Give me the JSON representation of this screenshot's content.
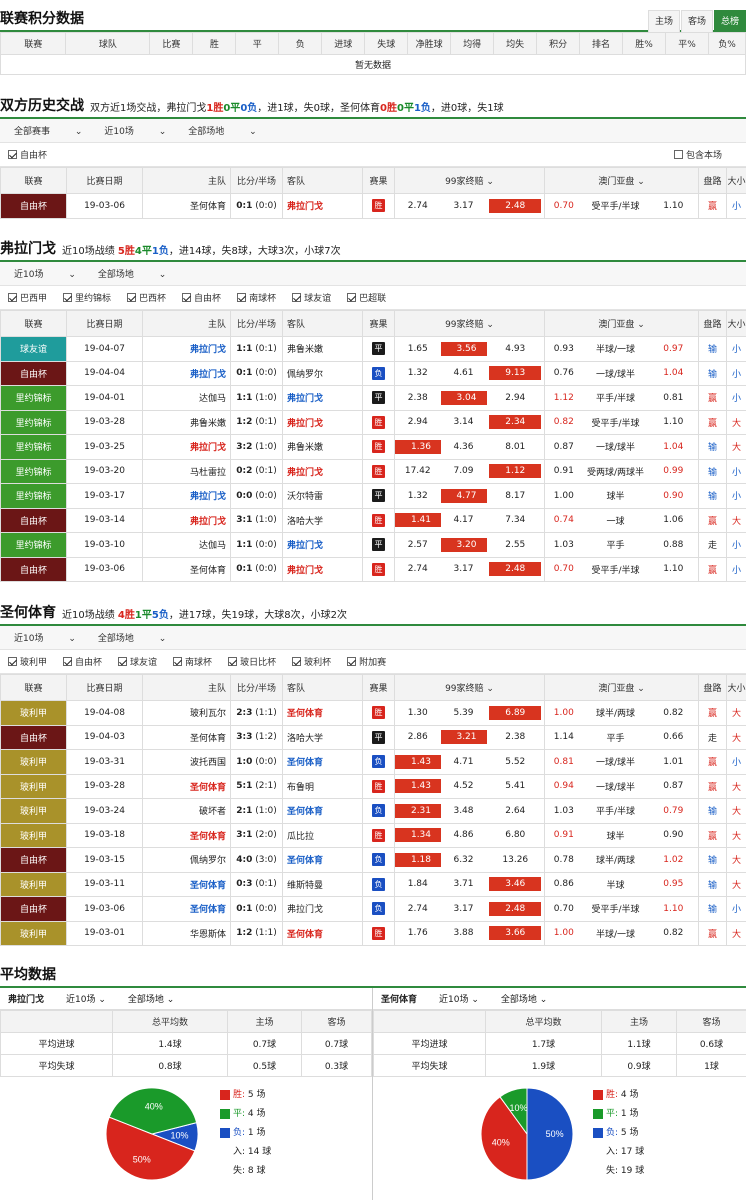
{
  "standings": {
    "title": "联赛积分数据",
    "tabs": [
      "主场",
      "客场",
      "总榜"
    ],
    "headers": [
      "联赛",
      "球队",
      "比赛",
      "胜",
      "平",
      "负",
      "进球",
      "失球",
      "净胜球",
      "均得",
      "均失",
      "积分",
      "排名",
      "胜%",
      "平%",
      "负%"
    ],
    "empty": "暂无数据"
  },
  "h2h": {
    "title": "双方历史交战",
    "summary": {
      "pre": "双方近1场交战，弗拉门戈",
      "w": "1胜",
      "d": "0平",
      "l": "0负",
      "mid": "，进1球，失0球，圣何体育",
      "w2": "0胜",
      "d2": "0平",
      "l2": "1负",
      "post": "，进0球，失1球"
    },
    "filters": [
      "全部赛事",
      "近10场",
      "全部场地"
    ],
    "checks": [
      "自由杯"
    ],
    "contain": "包含本场",
    "headers": [
      "联赛",
      "比赛日期",
      "主队",
      "比分/半场",
      "客队",
      "赛果",
      "99家终赔",
      "澳门亚盘",
      "盘路",
      "大小"
    ],
    "rows": [
      {
        "league": "自由杯",
        "lc": "zy",
        "date": "19-03-06",
        "home": "圣何体育",
        "hs": "n",
        "score": "0:1",
        "half": "(0:0)",
        "away": "弗拉门戈",
        "as": "r",
        "res": "胜",
        "rc": "w",
        "o1": "2.74",
        "o2": "3.17",
        "o3": "2.48",
        "hi": 3,
        "a1": "0.70",
        "a1c": "r",
        "hcp": "受平手/半球",
        "a2": "1.10",
        "a2c": "n",
        "pl": "赢",
        "plc": "r",
        "ou": "小",
        "ouc": "b"
      }
    ]
  },
  "flamengo": {
    "title": "弗拉门戈",
    "summary": {
      "pre": "近10场战绩",
      "w": "5胜",
      "d": "4平",
      "l": "1负",
      "post": "，进14球，失8球，大球3次，小球7次"
    },
    "filters": [
      "近10场",
      "全部场地"
    ],
    "checks": [
      "巴西甲",
      "里约锦标",
      "巴西杯",
      "自由杯",
      "南球杯",
      "球友谊",
      "巴超联"
    ],
    "rows": [
      {
        "league": "球友谊",
        "lc": "yq",
        "date": "19-04-07",
        "home": "弗拉门戈",
        "hs": "b",
        "score": "1:1",
        "half": "(0:1)",
        "away": "弗鲁米嫩",
        "as": "n",
        "res": "平",
        "rc": "d",
        "o1": "1.65",
        "o2": "3.56",
        "o3": "4.93",
        "hi": 2,
        "a1": "0.93",
        "a1c": "n",
        "hcp": "半球/一球",
        "a2": "0.97",
        "a2c": "r",
        "pl": "输",
        "plc": "b",
        "ou": "小",
        "ouc": "b"
      },
      {
        "league": "自由杯",
        "lc": "zy",
        "date": "19-04-04",
        "home": "弗拉门戈",
        "hs": "bl",
        "score": "0:1",
        "half": "(0:0)",
        "away": "佩纳罗尔",
        "as": "n",
        "res": "负",
        "rc": "l",
        "o1": "1.32",
        "o2": "4.61",
        "o3": "9.13",
        "hi": 3,
        "a1": "0.76",
        "a1c": "n",
        "hcp": "一球/球半",
        "a2": "1.04",
        "a2c": "r",
        "pl": "输",
        "plc": "b",
        "ou": "小",
        "ouc": "b"
      },
      {
        "league": "里约锦标",
        "lc": "ly",
        "date": "19-04-01",
        "home": "达伽马",
        "hs": "n",
        "score": "1:1",
        "half": "(1:0)",
        "away": "弗拉门戈",
        "as": "b",
        "res": "平",
        "rc": "d",
        "o1": "2.38",
        "o2": "3.04",
        "o3": "2.94",
        "hi": 2,
        "a1": "1.12",
        "a1c": "r",
        "hcp": "平手/半球",
        "a2": "0.81",
        "a2c": "n",
        "pl": "赢",
        "plc": "r",
        "ou": "小",
        "ouc": "b"
      },
      {
        "league": "里约锦标",
        "lc": "ly",
        "date": "19-03-28",
        "home": "弗鲁米嫩",
        "hs": "n",
        "score": "1:2",
        "half": "(0:1)",
        "away": "弗拉门戈",
        "as": "r",
        "res": "胜",
        "rc": "w",
        "o1": "2.94",
        "o2": "3.14",
        "o3": "2.34",
        "hi": 3,
        "a1": "0.82",
        "a1c": "r",
        "hcp": "受平手/半球",
        "a2": "1.10",
        "a2c": "n",
        "pl": "赢",
        "plc": "r",
        "ou": "大",
        "ouc": "r"
      },
      {
        "league": "里约锦标",
        "lc": "ly",
        "date": "19-03-25",
        "home": "弗拉门戈",
        "hs": "r",
        "score": "3:2",
        "half": "(1:0)",
        "away": "弗鲁米嫩",
        "as": "n",
        "res": "胜",
        "rc": "w",
        "o1": "1.36",
        "o2": "4.36",
        "o3": "8.01",
        "hi": 1,
        "a1": "0.87",
        "a1c": "n",
        "hcp": "一球/球半",
        "a2": "1.04",
        "a2c": "r",
        "pl": "输",
        "plc": "b",
        "ou": "大",
        "ouc": "r"
      },
      {
        "league": "里约锦标",
        "lc": "ly",
        "date": "19-03-20",
        "home": "马杜雷拉",
        "hs": "n",
        "score": "0:2",
        "half": "(0:1)",
        "away": "弗拉门戈",
        "as": "r",
        "res": "胜",
        "rc": "w",
        "o1": "17.42",
        "o2": "7.09",
        "o3": "1.12",
        "hi": 3,
        "a1": "0.91",
        "a1c": "n",
        "hcp": "受两球/两球半",
        "a2": "0.99",
        "a2c": "r",
        "pl": "输",
        "plc": "b",
        "ou": "小",
        "ouc": "b"
      },
      {
        "league": "里约锦标",
        "lc": "ly",
        "date": "19-03-17",
        "home": "弗拉门戈",
        "hs": "b",
        "score": "0:0",
        "half": "(0:0)",
        "away": "沃尔特雷",
        "as": "n",
        "res": "平",
        "rc": "d",
        "o1": "1.32",
        "o2": "4.77",
        "o3": "8.17",
        "hi": 2,
        "a1": "1.00",
        "a1c": "n",
        "hcp": "球半",
        "a2": "0.90",
        "a2c": "r",
        "pl": "输",
        "plc": "b",
        "ou": "小",
        "ouc": "b"
      },
      {
        "league": "自由杯",
        "lc": "zy",
        "date": "19-03-14",
        "home": "弗拉门戈",
        "hs": "r",
        "score": "3:1",
        "half": "(1:0)",
        "away": "洛哈大学",
        "as": "n",
        "res": "胜",
        "rc": "w",
        "o1": "1.41",
        "o2": "4.17",
        "o3": "7.34",
        "hi": 1,
        "a1": "0.74",
        "a1c": "r",
        "hcp": "一球",
        "a2": "1.06",
        "a2c": "n",
        "pl": "赢",
        "plc": "r",
        "ou": "大",
        "ouc": "r"
      },
      {
        "league": "里约锦标",
        "lc": "ly",
        "date": "19-03-10",
        "home": "达伽马",
        "hs": "n",
        "score": "1:1",
        "half": "(0:0)",
        "away": "弗拉门戈",
        "as": "b",
        "res": "平",
        "rc": "d",
        "o1": "2.57",
        "o2": "3.20",
        "o3": "2.55",
        "hi": 2,
        "a1": "1.03",
        "a1c": "n",
        "hcp": "平手",
        "a2": "0.88",
        "a2c": "n",
        "pl": "走",
        "plc": "n",
        "ou": "小",
        "ouc": "b"
      },
      {
        "league": "自由杯",
        "lc": "zy",
        "date": "19-03-06",
        "home": "圣何体育",
        "hs": "n",
        "score": "0:1",
        "half": "(0:0)",
        "away": "弗拉门戈",
        "as": "r",
        "res": "胜",
        "rc": "w",
        "o1": "2.74",
        "o2": "3.17",
        "o3": "2.48",
        "hi": 3,
        "a1": "0.70",
        "a1c": "r",
        "hcp": "受平手/半球",
        "a2": "1.10",
        "a2c": "n",
        "pl": "赢",
        "plc": "r",
        "ou": "小",
        "ouc": "b"
      }
    ]
  },
  "sanjose": {
    "title": "圣何体育",
    "summary": {
      "pre": "近10场战绩",
      "w": "4胜",
      "d": "1平",
      "l": "5负",
      "post": "，进17球，失19球，大球8次，小球2次"
    },
    "filters": [
      "近10场",
      "全部场地"
    ],
    "checks": [
      "玻利甲",
      "自由杯",
      "球友谊",
      "南球杯",
      "玻日比杯",
      "玻利杯",
      "附加赛"
    ],
    "rows": [
      {
        "league": "玻利甲",
        "lc": "bl",
        "date": "19-04-08",
        "home": "玻利瓦尔",
        "hs": "n",
        "score": "2:3",
        "half": "(1:1)",
        "away": "圣何体育",
        "as": "r",
        "res": "胜",
        "rc": "w",
        "o1": "1.30",
        "o2": "5.39",
        "o3": "6.89",
        "hi": 3,
        "a1": "1.00",
        "a1c": "r",
        "hcp": "球半/两球",
        "a2": "0.82",
        "a2c": "n",
        "pl": "赢",
        "plc": "r",
        "ou": "大",
        "ouc": "r"
      },
      {
        "league": "自由杯",
        "lc": "zy",
        "date": "19-04-03",
        "home": "圣何体育",
        "hs": "n",
        "score": "3:3",
        "half": "(1:2)",
        "away": "洛哈大学",
        "as": "n",
        "res": "平",
        "rc": "d",
        "o1": "2.86",
        "o2": "3.21",
        "o3": "2.38",
        "hi": 2,
        "a1": "1.14",
        "a1c": "n",
        "hcp": "平手",
        "a2": "0.66",
        "a2c": "n",
        "pl": "走",
        "plc": "n",
        "ou": "大",
        "ouc": "r"
      },
      {
        "league": "玻利甲",
        "lc": "bl",
        "date": "19-03-31",
        "home": "波托西国",
        "hs": "n",
        "score": "1:0",
        "half": "(0:0)",
        "away": "圣何体育",
        "as": "b",
        "res": "负",
        "rc": "l",
        "o1": "1.43",
        "o2": "4.71",
        "o3": "5.52",
        "hi": 1,
        "a1": "0.81",
        "a1c": "r",
        "hcp": "一球/球半",
        "a2": "1.01",
        "a2c": "n",
        "pl": "赢",
        "plc": "r",
        "ou": "小",
        "ouc": "b"
      },
      {
        "league": "玻利甲",
        "lc": "bl",
        "date": "19-03-28",
        "home": "圣何体育",
        "hs": "r",
        "score": "5:1",
        "half": "(2:1)",
        "away": "布鲁明",
        "as": "n",
        "res": "胜",
        "rc": "w",
        "o1": "1.43",
        "o2": "4.52",
        "o3": "5.41",
        "hi": 1,
        "a1": "0.94",
        "a1c": "r",
        "hcp": "一球/球半",
        "a2": "0.87",
        "a2c": "n",
        "pl": "赢",
        "plc": "r",
        "ou": "大",
        "ouc": "r"
      },
      {
        "league": "玻利甲",
        "lc": "bl",
        "date": "19-03-24",
        "home": "破坏者",
        "hs": "n",
        "score": "2:1",
        "half": "(1:0)",
        "away": "圣何体育",
        "as": "b",
        "res": "负",
        "rc": "l",
        "o1": "2.31",
        "o2": "3.48",
        "o3": "2.64",
        "hi": 1,
        "a1": "1.03",
        "a1c": "n",
        "hcp": "平手/半球",
        "a2": "0.79",
        "a2c": "r",
        "pl": "输",
        "plc": "b",
        "ou": "大",
        "ouc": "r"
      },
      {
        "league": "玻利甲",
        "lc": "bl",
        "date": "19-03-18",
        "home": "圣何体育",
        "hs": "r",
        "score": "3:1",
        "half": "(2:0)",
        "away": "瓜比拉",
        "as": "n",
        "res": "胜",
        "rc": "w",
        "o1": "1.34",
        "o2": "4.86",
        "o3": "6.80",
        "hi": 1,
        "a1": "0.91",
        "a1c": "r",
        "hcp": "球半",
        "a2": "0.90",
        "a2c": "n",
        "pl": "赢",
        "plc": "r",
        "ou": "大",
        "ouc": "r"
      },
      {
        "league": "自由杯",
        "lc": "zy",
        "date": "19-03-15",
        "home": "佩纳罗尔",
        "hs": "n",
        "score": "4:0",
        "half": "(3:0)",
        "away": "圣何体育",
        "as": "b",
        "res": "负",
        "rc": "l",
        "o1": "1.18",
        "o2": "6.32",
        "o3": "13.26",
        "hi": 1,
        "a1": "0.78",
        "a1c": "n",
        "hcp": "球半/两球",
        "a2": "1.02",
        "a2c": "r",
        "pl": "输",
        "plc": "b",
        "ou": "大",
        "ouc": "r"
      },
      {
        "league": "玻利甲",
        "lc": "bl",
        "date": "19-03-11",
        "home": "圣何体育",
        "hs": "b",
        "score": "0:3",
        "half": "(0:1)",
        "away": "维斯特曼",
        "as": "n",
        "res": "负",
        "rc": "l",
        "o1": "1.84",
        "o2": "3.71",
        "o3": "3.46",
        "hi": 3,
        "a1": "0.86",
        "a1c": "n",
        "hcp": "半球",
        "a2": "0.95",
        "a2c": "r",
        "pl": "输",
        "plc": "b",
        "ou": "大",
        "ouc": "r"
      },
      {
        "league": "自由杯",
        "lc": "zy",
        "date": "19-03-06",
        "home": "圣何体育",
        "hs": "b",
        "score": "0:1",
        "half": "(0:0)",
        "away": "弗拉门戈",
        "as": "n",
        "res": "负",
        "rc": "l",
        "o1": "2.74",
        "o2": "3.17",
        "o3": "2.48",
        "hi": 3,
        "a1": "0.70",
        "a1c": "n",
        "hcp": "受平手/半球",
        "a2": "1.10",
        "a2c": "r",
        "pl": "输",
        "plc": "b",
        "ou": "小",
        "ouc": "b"
      },
      {
        "league": "玻利甲",
        "lc": "bl",
        "date": "19-03-01",
        "home": "华恩斯体",
        "hs": "n",
        "score": "1:2",
        "half": "(1:1)",
        "away": "圣何体育",
        "as": "r",
        "res": "胜",
        "rc": "w",
        "o1": "1.76",
        "o2": "3.88",
        "o3": "3.66",
        "hi": 3,
        "a1": "1.00",
        "a1c": "r",
        "hcp": "半球/一球",
        "a2": "0.82",
        "a2c": "n",
        "pl": "赢",
        "plc": "r",
        "ou": "大",
        "ouc": "r"
      }
    ]
  },
  "avg": {
    "title": "平均数据",
    "left": {
      "team": "弗拉门戈",
      "filters": [
        "近10场",
        "全部场地"
      ],
      "headers": [
        "",
        "总平均数",
        "主场",
        "客场"
      ],
      "rows": [
        [
          "平均进球",
          "1.4球",
          "0.7球",
          "0.7球"
        ],
        [
          "平均失球",
          "0.8球",
          "0.5球",
          "0.3球"
        ]
      ],
      "pie": {
        "win": 50,
        "draw": 40,
        "loss": 10
      },
      "legend": [
        [
          "胜:",
          "5 场"
        ],
        [
          "平:",
          "4 场"
        ],
        [
          "负:",
          "1 场"
        ],
        [
          "入:",
          "14 球"
        ],
        [
          "失:",
          "8 球"
        ]
      ]
    },
    "right": {
      "team": "圣何体育",
      "filters": [
        "近10场",
        "全部场地"
      ],
      "headers": [
        "",
        "总平均数",
        "主场",
        "客场"
      ],
      "rows": [
        [
          "平均进球",
          "1.7球",
          "1.1球",
          "0.6球"
        ],
        [
          "平均失球",
          "1.9球",
          "0.9球",
          "1球"
        ]
      ],
      "pie": {
        "win": 40,
        "draw": 10,
        "loss": 50
      },
      "legend": [
        [
          "胜:",
          "4 场"
        ],
        [
          "平:",
          "1 场"
        ],
        [
          "负:",
          "5 场"
        ],
        [
          "入:",
          "17 球"
        ],
        [
          "失:",
          "19 球"
        ]
      ]
    },
    "colors": {
      "win": "#d8251d",
      "draw": "#1a9a2a",
      "loss": "#1a4fc2"
    }
  }
}
